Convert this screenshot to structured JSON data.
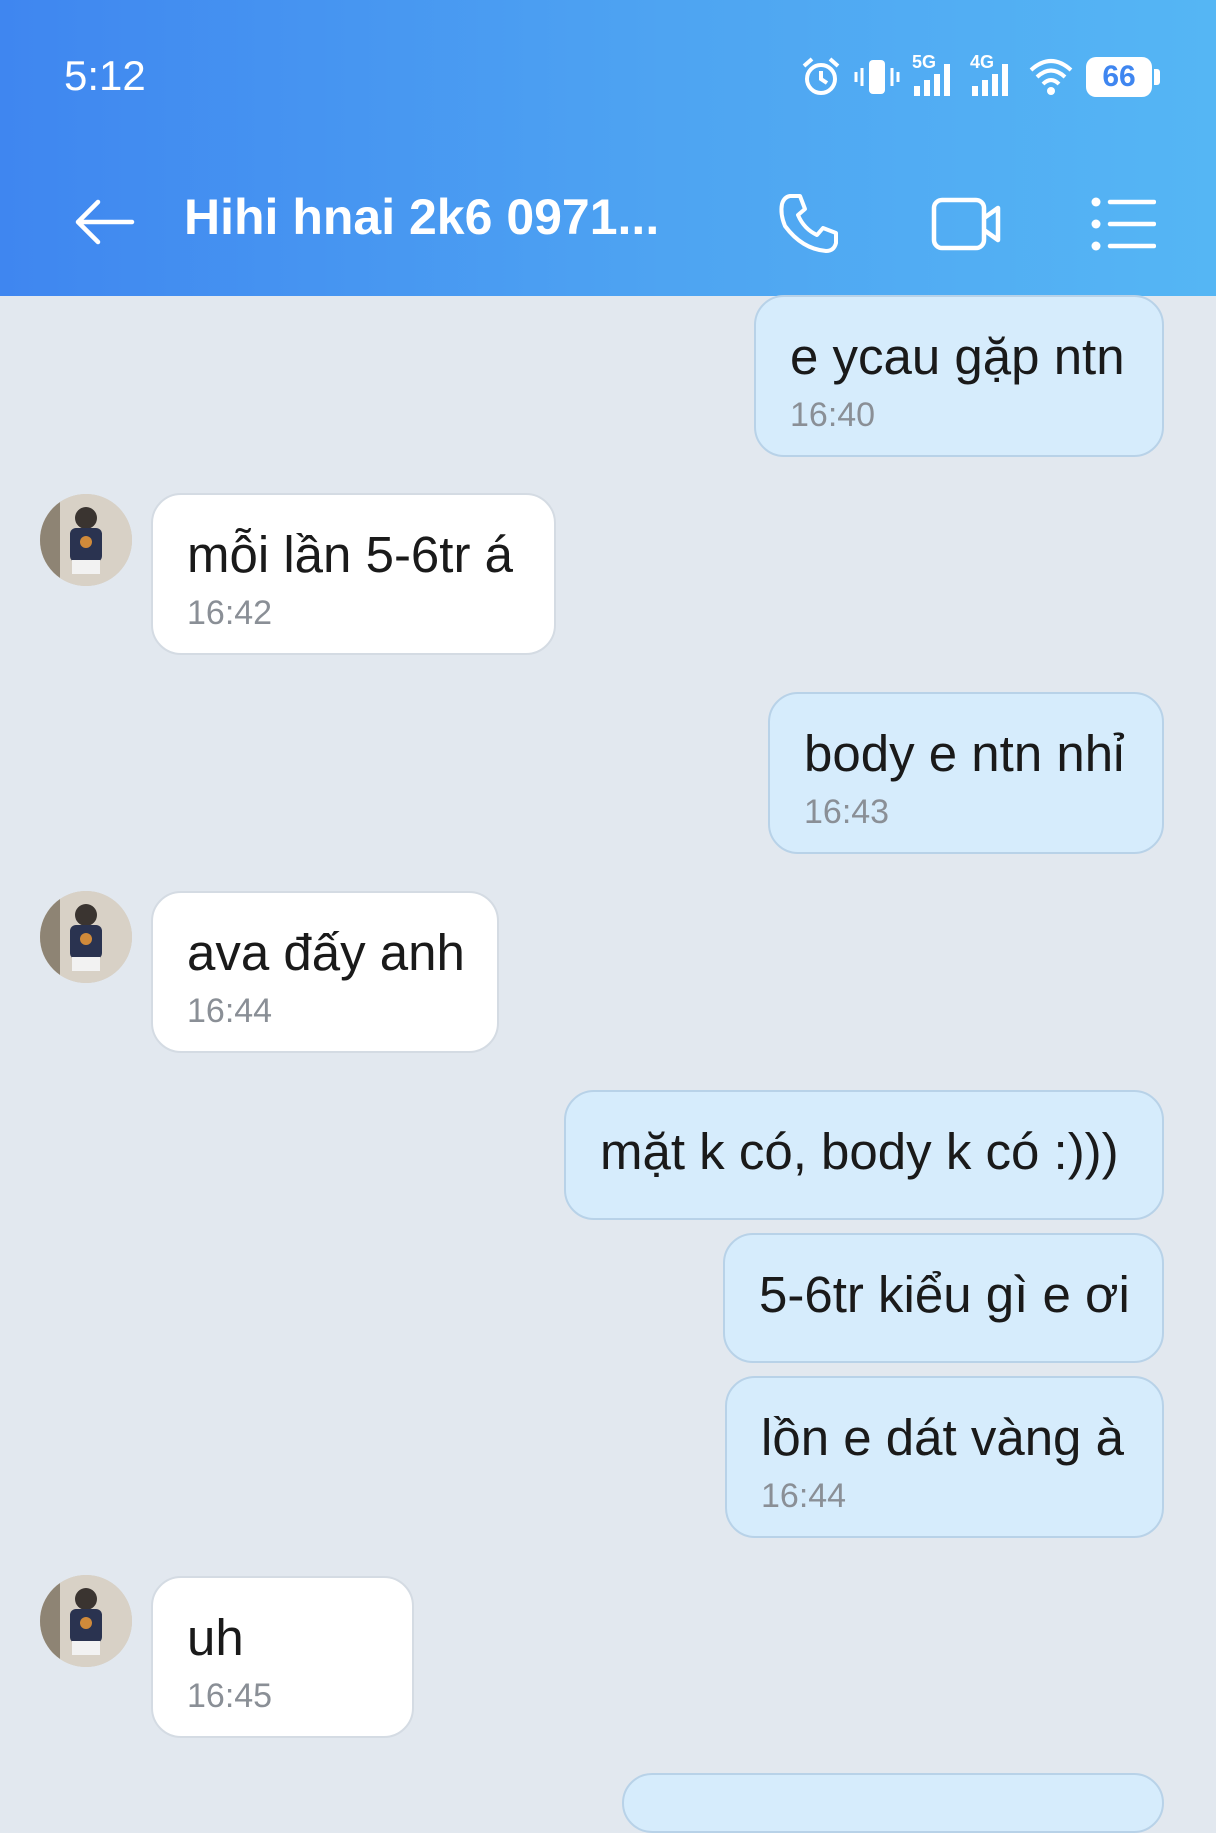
{
  "status_bar": {
    "time": "5:12",
    "network_1": "5G",
    "network_2": "4G",
    "battery": "66"
  },
  "header": {
    "title": "Hihi hnai 2k6 0971...",
    "back_icon": "arrow-left-icon",
    "call_icon": "phone-icon",
    "video_icon": "video-camera-icon",
    "menu_icon": "list-menu-icon"
  },
  "colors": {
    "header_start": "#3f86f0",
    "header_end": "#55b6f4",
    "outgoing_bubble": "#d6ecfc",
    "incoming_bubble": "#ffffff",
    "background": "#e2e8ef"
  },
  "messages": [
    {
      "direction": "outgoing",
      "text": "e ycau gặp ntn",
      "time": "16:40"
    },
    {
      "direction": "incoming",
      "text": "mỗi lần 5-6tr á",
      "time": "16:42"
    },
    {
      "direction": "outgoing",
      "text": "body e ntn nhỉ",
      "time": "16:43"
    },
    {
      "direction": "incoming",
      "text": "ava đấy anh",
      "time": "16:44"
    },
    {
      "direction": "outgoing",
      "text": "mặt k có, body k có :)))",
      "time": ""
    },
    {
      "direction": "outgoing",
      "text": "5-6tr kiểu gì e ơi",
      "time": ""
    },
    {
      "direction": "outgoing",
      "text": "lồn e dát vàng à",
      "time": "16:44"
    },
    {
      "direction": "incoming",
      "text": "uh",
      "time": "16:45"
    }
  ]
}
